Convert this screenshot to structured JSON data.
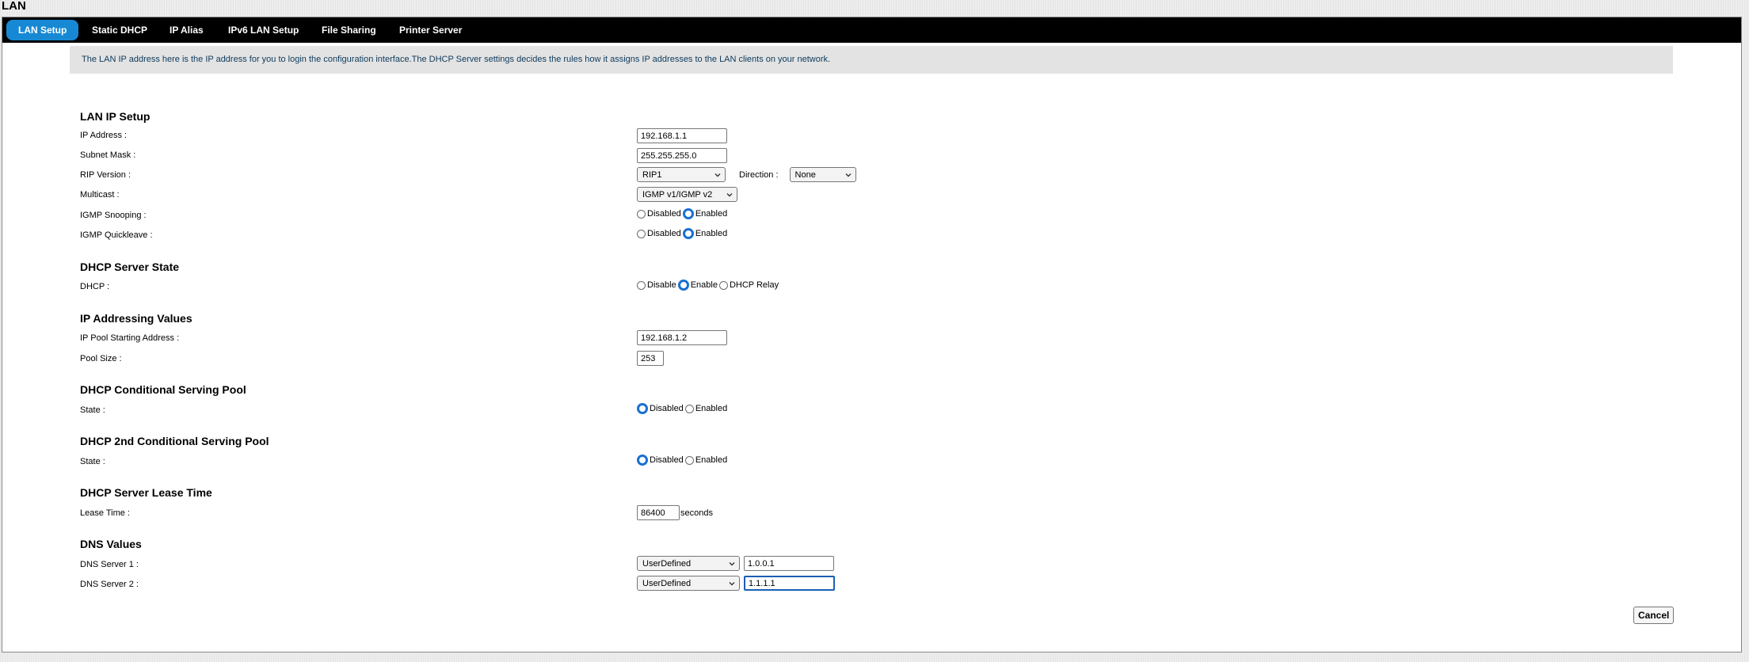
{
  "page_title": "LAN",
  "tabs": [
    "LAN Setup",
    "Static DHCP",
    "IP Alias",
    "IPv6 LAN Setup",
    "File Sharing",
    "Printer Server"
  ],
  "intro_text": "The LAN IP address here is the IP address for you to login the configuration interface.The DHCP Server settings decides the rules how it assigns IP addresses to the LAN clients on your network.",
  "lan_ip_setup": {
    "title": "LAN IP Setup",
    "ip_address_label": "IP Address :",
    "ip_address": "192.168.1.1",
    "subnet_mask_label": "Subnet Mask :",
    "subnet_mask": "255.255.255.0",
    "rip_version_label": "RIP Version :",
    "rip_version": "RIP1",
    "direction_label": "Direction :",
    "direction": "None",
    "multicast_label": "Multicast :",
    "multicast": "IGMP v1/IGMP v2",
    "igmp_snooping_label": "IGMP Snooping :",
    "igmp_quickleave_label": "IGMP Quickleave :",
    "disabled": "Disabled",
    "enabled": "Enabled"
  },
  "dhcp_server_state": {
    "title": "DHCP Server State",
    "dhcp_label": "DHCP :",
    "disable": "Disable",
    "enable": "Enable",
    "relay": "DHCP Relay"
  },
  "ip_addressing": {
    "title": "IP Addressing Values",
    "pool_start_label": "IP Pool Starting Address :",
    "pool_start": "192.168.1.2",
    "pool_size_label": "Pool Size :",
    "pool_size": "253"
  },
  "conditional_pool": {
    "title": "DHCP Conditional Serving Pool",
    "state_label": "State :"
  },
  "second_conditional_pool": {
    "title": "DHCP 2nd Conditional Serving Pool",
    "state_label": "State :"
  },
  "lease": {
    "title": "DHCP Server Lease Time",
    "lease_label": "Lease Time :",
    "lease_value": "86400",
    "unit": "seconds"
  },
  "dns": {
    "title": "DNS Values",
    "dns1_label": "DNS Server 1 :",
    "dns1_mode": "UserDefined",
    "dns1_value": "1.0.0.1",
    "dns2_label": "DNS Server 2 :",
    "dns2_mode": "UserDefined",
    "dns2_value": "1.1.1.1"
  },
  "cancel_label": "Cancel",
  "colors": {
    "tabbar": "#000000",
    "active_tab": "#1789d4",
    "radio_selected": "#1a6fd1",
    "intro_bg": "#e3e3e3"
  }
}
